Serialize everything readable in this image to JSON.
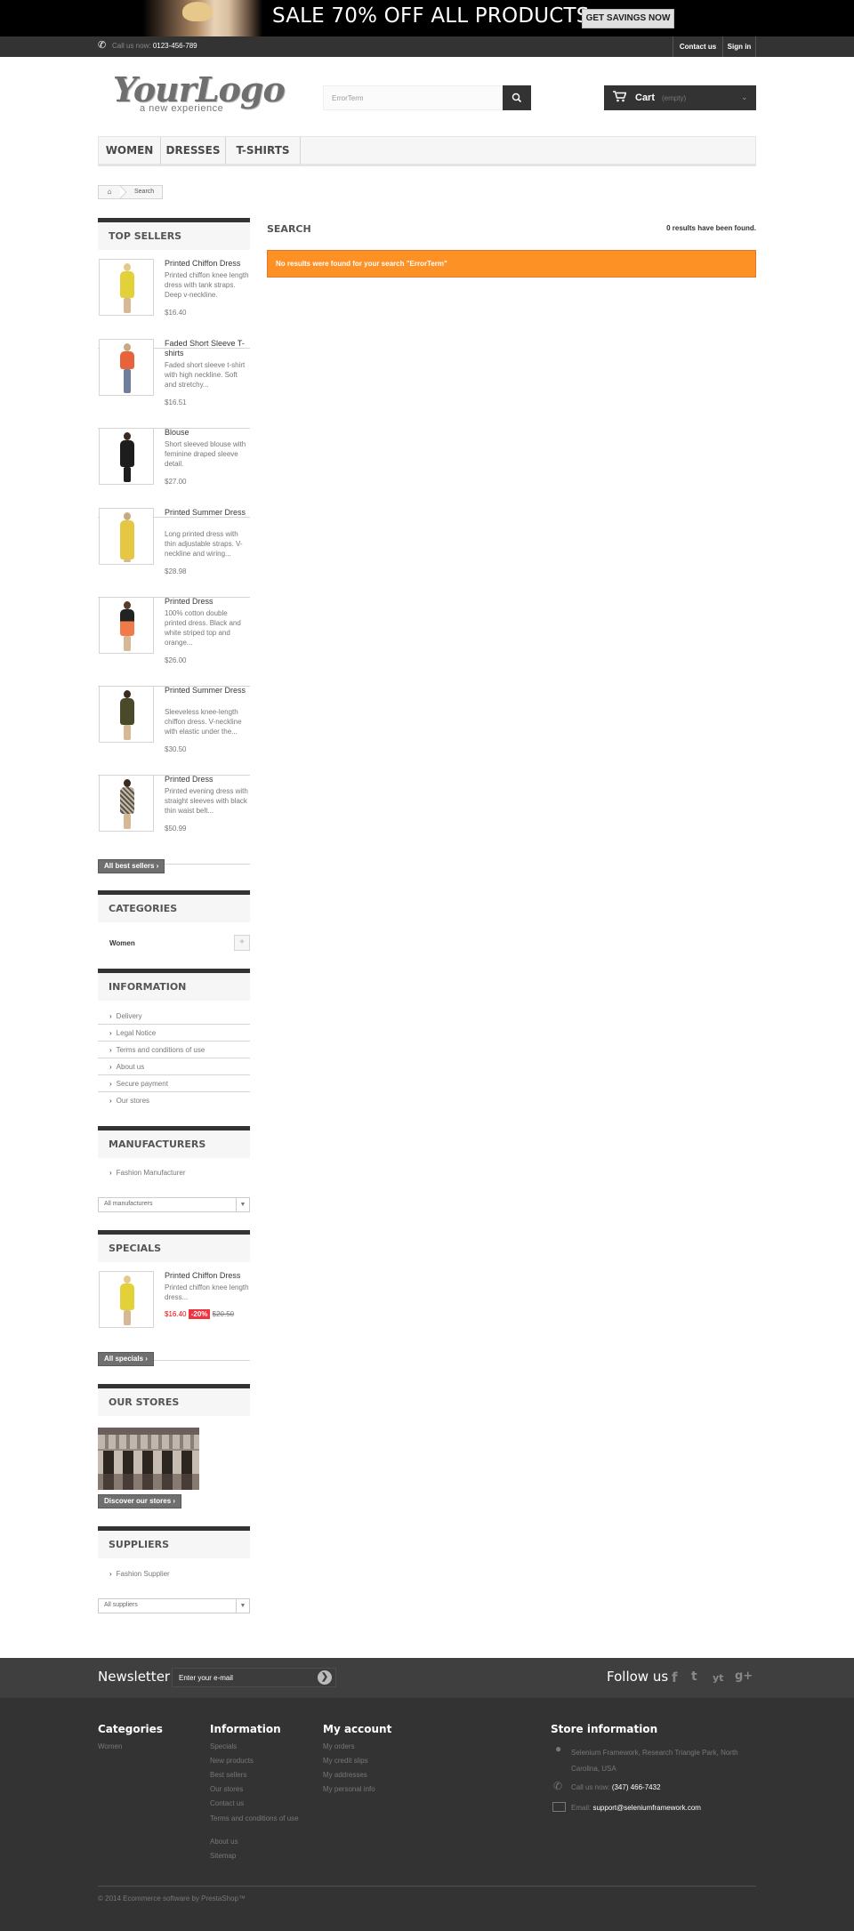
{
  "banner": {
    "sale_text": "SALE 70% OFF ALL PRODUCTS",
    "button": "GET SAVINGS NOW"
  },
  "topnav": {
    "call_label": "Call us now:",
    "phone": "0123-456-789",
    "contact": "Contact us",
    "signin": "Sign in"
  },
  "logo": {
    "main": "YourLogo",
    "tagline": "a new experience"
  },
  "search": {
    "value": "ErrorTerm"
  },
  "cart": {
    "label": "Cart",
    "status": "(empty)"
  },
  "menu": [
    "WOMEN",
    "DRESSES",
    "T-SHIRTS"
  ],
  "breadcrumb": {
    "current": "Search"
  },
  "content": {
    "title": "SEARCH",
    "results_count": "0 results have been found.",
    "warning": "No results were found for your search \"ErrorTerm\""
  },
  "top_sellers": {
    "title": "TOP SELLERS",
    "products": [
      {
        "name": "Printed Chiffon Dress",
        "desc": "Printed chiffon knee length dress with tank straps. Deep v-neckline.",
        "price": "$16.40"
      },
      {
        "name": "Faded Short Sleeve T-shirts",
        "desc": "Faded short sleeve t-shirt with high neckline. Soft and stretchy...",
        "price": "$16.51"
      },
      {
        "name": "Blouse",
        "desc": "Short sleeved blouse with feminine draped sleeve detail.",
        "price": "$27.00"
      },
      {
        "name": "Printed Summer Dress",
        "desc": "Long printed dress with thin adjustable straps. V-neckline and wiring...",
        "price": "$28.98"
      },
      {
        "name": "Printed Dress",
        "desc": "100% cotton double printed dress. Black and white striped top and orange...",
        "price": "$26.00"
      },
      {
        "name": "Printed Summer Dress",
        "desc": "Sleeveless knee-length chiffon dress. V-neckline with elastic under the...",
        "price": "$30.50"
      },
      {
        "name": "Printed Dress",
        "desc": "Printed evening dress with straight sleeves with black thin waist belt...",
        "price": "$50.99"
      }
    ],
    "button": "All best sellers"
  },
  "categories": {
    "title": "CATEGORIES",
    "items": [
      "Women"
    ],
    "expand": "+"
  },
  "information": {
    "title": "INFORMATION",
    "items": [
      "Delivery",
      "Legal Notice",
      "Terms and conditions of use",
      "About us",
      "Secure payment",
      "Our stores"
    ]
  },
  "manufacturers": {
    "title": "MANUFACTURERS",
    "items": [
      "Fashion Manufacturer"
    ],
    "select": "All manufacturers"
  },
  "specials": {
    "title": "SPECIALS",
    "name": "Printed Chiffon Dress",
    "desc": "Printed chiffon knee length dress...",
    "price": "$16.40",
    "discount": "-20%",
    "old_price": "$20.50",
    "button": "All specials"
  },
  "stores": {
    "title": "OUR STORES",
    "button": "Discover our stores"
  },
  "suppliers": {
    "title": "SUPPLIERS",
    "items": [
      "Fashion Supplier"
    ],
    "select": "All suppliers"
  },
  "newsletter": {
    "title": "Newsletter",
    "placeholder": "Enter your e-mail",
    "follow": "Follow us",
    "social": [
      "f",
      "t",
      "yt",
      "g+"
    ]
  },
  "footer": {
    "categories": {
      "title": "Categories",
      "items": [
        "Women"
      ]
    },
    "information": {
      "title": "Information",
      "items": [
        "Specials",
        "New products",
        "Best sellers",
        "Our stores",
        "Contact us",
        "Terms and conditions of use",
        "About us",
        "Sitemap"
      ]
    },
    "account": {
      "title": "My account",
      "items": [
        "My orders",
        "My credit slips",
        "My addresses",
        "My personal info"
      ]
    },
    "store": {
      "title": "Store information",
      "address": "Selenium Framework, Research Triangle Park, North Carolina, USA",
      "call_label": "Call us now:",
      "phone": "(347) 466-7432",
      "email_label": "Email:",
      "email": "support@seleniumframework.com"
    },
    "copyright": "© 2014 Ecommerce software by PrestaShop™"
  },
  "colors": {
    "warning": "#fe9126",
    "dark": "#333333",
    "discount": "#f13340",
    "price_special": "#f00"
  }
}
